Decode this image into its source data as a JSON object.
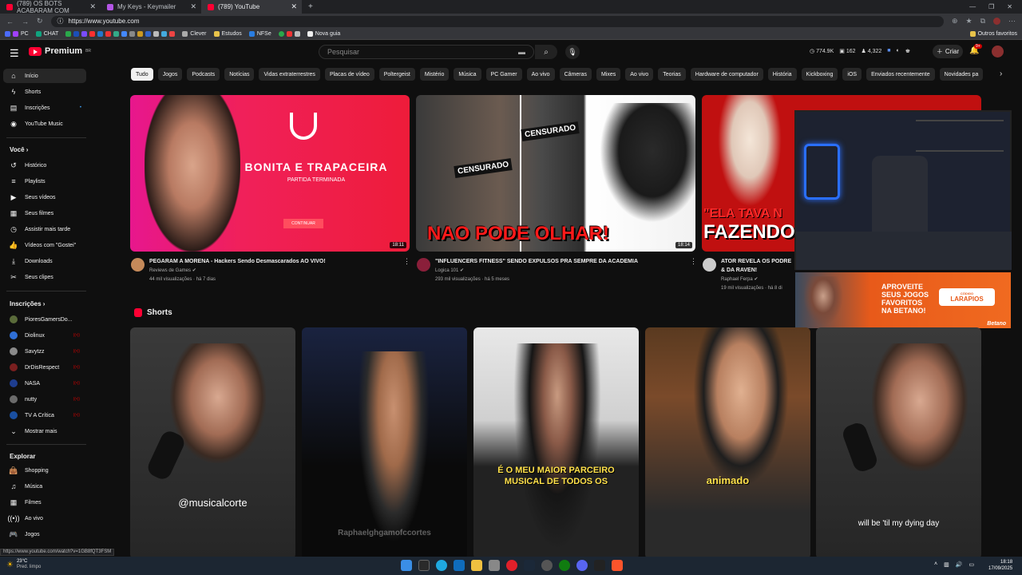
{
  "browser": {
    "tabs": [
      {
        "label": "(789) OS BOTS ACABARAM COM"
      },
      {
        "label": "My Keys - Keymailer"
      },
      {
        "label": "(789) YouTube"
      }
    ],
    "url": "https://www.youtube.com",
    "bookmarks": [
      "PC",
      "CHAT",
      "Clever",
      "Estudos",
      "NFSe",
      "Nova guia"
    ],
    "other_bookmarks": "Outros favoritos",
    "status_url": "https://www.youtube.com/watch?v=1GB8fQT3FSM"
  },
  "header": {
    "logo": "Premium",
    "logo_sup": "BR",
    "search_placeholder": "Pesquisar",
    "stats": [
      "774.9K",
      "162",
      "4,322"
    ],
    "create_label": "Criar",
    "notif_count": "9+"
  },
  "sidebar": {
    "main": [
      {
        "label": "Início"
      },
      {
        "label": "Shorts"
      },
      {
        "label": "Inscrições"
      },
      {
        "label": "YouTube Music"
      }
    ],
    "you_heading": "Você",
    "you": [
      {
        "label": "Histórico"
      },
      {
        "label": "Playlists"
      },
      {
        "label": "Seus vídeos"
      },
      {
        "label": "Seus filmes"
      },
      {
        "label": "Assistir mais tarde"
      },
      {
        "label": "Vídeos com \"Gostei\""
      },
      {
        "label": "Downloads"
      },
      {
        "label": "Seus clipes"
      }
    ],
    "subs_heading": "Inscrições",
    "subs": [
      {
        "label": "PioresGamersDo...",
        "color": "#5a6b3a"
      },
      {
        "label": "Diolinux",
        "color": "#2f6fd6"
      },
      {
        "label": "Savytzz",
        "color": "#8a8a8a"
      },
      {
        "label": "DrDisRespect",
        "color": "#7a1f1f"
      },
      {
        "label": "NASA",
        "color": "#1e3d8f"
      },
      {
        "label": "nutty",
        "color": "#6b6b6b"
      },
      {
        "label": "TV A Crítica",
        "color": "#1a4fa0"
      }
    ],
    "show_more": "Mostrar mais",
    "explore_heading": "Explorar",
    "explore": [
      {
        "label": "Shopping"
      },
      {
        "label": "Música"
      },
      {
        "label": "Filmes"
      },
      {
        "label": "Ao vivo"
      },
      {
        "label": "Jogos"
      }
    ]
  },
  "chips": [
    "Tudo",
    "Jogos",
    "Podcasts",
    "Notícias",
    "Vidas extraterrestres",
    "Placas de vídeo",
    "Poltergeist",
    "Mistério",
    "Música",
    "PC Gamer",
    "Ao vivo",
    "Câmeras",
    "Mixes",
    "Ao vivo",
    "Teorias",
    "Hardware de computador",
    "História",
    "Kickboxing",
    "iOS",
    "Enviados recentemente",
    "Novidades pa"
  ],
  "videos": [
    {
      "title": "PEGARAM A MORENA - Hackers Sendo Desmascarados AO VIVO!",
      "channel": "Reviews de Games",
      "meta": "44 mil visualizações · há 7 dias",
      "duration": "18:11",
      "thumb_title": "BONITA E TRAPACEIRA",
      "thumb_sub": "PARTIDA TERMINADA",
      "thumb_btn": "CONTINUAR"
    },
    {
      "title": "\"INFLUENCERS FITNESS\" SENDO EXPULSOS PRA SEMPRE DA ACADEMIA",
      "channel": "Logica 101",
      "meta": "293 mil visualizações · há 5 meses",
      "duration": "18:14",
      "thumb_title": "NAO PODE OLHAR!",
      "thumb_tag1": "CENSURADO",
      "thumb_tag2": "CENSURADO"
    },
    {
      "title": "ATOR REVELA OS PODRE",
      "title2": "& DA RAVEN!",
      "channel": "Raphael Ferpa",
      "meta": "19 mil visualizações · há 8 di",
      "thumb_title1": "\"ELA TAVA N",
      "thumb_title2": "FAZENDO"
    }
  ],
  "shorts_heading": "Shorts",
  "shorts": [
    {
      "caption": "@musicalcorte"
    },
    {
      "caption": "Raphaelghgamofccortes"
    },
    {
      "caption": "É O MEU MAIOR PARCEIRO MUSICAL DE TODOS OS"
    },
    {
      "caption": "animado"
    },
    {
      "caption": "will be 'til my dying day"
    }
  ],
  "ad": {
    "text1": "APROVEITE",
    "text2": "SEUS JOGOS",
    "text3": "FAVORITOS",
    "text4": "NA BETANO!",
    "code_label": "CÓDIGO",
    "code": "LARAPIOS",
    "brand": "Betano"
  },
  "taskbar": {
    "weather_temp": "23°C",
    "weather_desc": "Pred. limpo",
    "time": "18:18",
    "date": "17/09/2025"
  }
}
